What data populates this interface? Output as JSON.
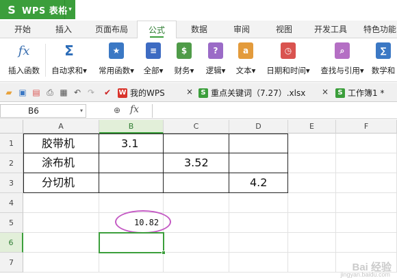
{
  "app": {
    "name": "WPS 表格",
    "logo_glyph": "S",
    "accent": "#3b9e3b"
  },
  "menu": {
    "tabs": [
      {
        "label": "开始"
      },
      {
        "label": "插入"
      },
      {
        "label": "页面布局"
      },
      {
        "label": "公式",
        "active": true
      },
      {
        "label": "数据"
      },
      {
        "label": "审阅"
      },
      {
        "label": "视图"
      },
      {
        "label": "开发工具"
      },
      {
        "label": "特色功能"
      }
    ]
  },
  "ribbon": {
    "items": [
      {
        "label": "插入函数",
        "icon": "fx-icon",
        "glyph": "fx"
      },
      {
        "label": "自动求和",
        "icon": "sigma-icon",
        "glyph": "Σ"
      },
      {
        "label": "常用函数",
        "icon": "star-book-icon",
        "glyph": "★"
      },
      {
        "label": "全部",
        "icon": "book-all-icon",
        "glyph": "≡"
      },
      {
        "label": "财务",
        "icon": "finance-icon",
        "glyph": "$"
      },
      {
        "label": "逻辑",
        "icon": "logic-icon",
        "glyph": "?"
      },
      {
        "label": "文本",
        "icon": "text-icon",
        "glyph": "a"
      },
      {
        "label": "日期和时间",
        "icon": "clock-icon",
        "glyph": "◷"
      },
      {
        "label": "查找与引用",
        "icon": "search-book-icon",
        "glyph": "⌕"
      },
      {
        "label": "数学和",
        "icon": "math-icon",
        "glyph": "∑"
      }
    ],
    "dropdown_marker": "▾"
  },
  "quick_access": {
    "doc_tabs": [
      {
        "label": "我的WPS",
        "close": "×"
      },
      {
        "label": "重点关键词（7.27）.xlsx",
        "close": "×"
      },
      {
        "label": "工作簿1 *"
      }
    ]
  },
  "formula_bar": {
    "cell_ref": "B6",
    "fx": "fx",
    "dropdown": "▾",
    "zoom_glyph": "⊕"
  },
  "sheet": {
    "columns": [
      "A",
      "B",
      "C",
      "D",
      "E",
      "F"
    ],
    "rows": [
      "1",
      "2",
      "3",
      "4",
      "5",
      "6",
      "7"
    ],
    "cells": {
      "A1": "胶带机",
      "B1": "3.1",
      "A2": "涂布机",
      "C2": "3.52",
      "A3": "分切机",
      "D3": "4.2",
      "B5": "10.82"
    },
    "selected_cell": "B6"
  },
  "watermark": {
    "brand": "Bai 经验",
    "url": "jingyan.baidu.com"
  }
}
